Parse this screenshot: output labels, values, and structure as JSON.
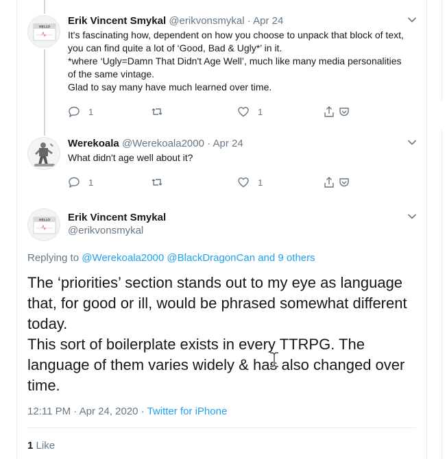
{
  "thread": [
    {
      "name": "Erik Vincent Smykal",
      "handle": "@erikvonsmykal",
      "separator": "·",
      "date": "Apr 24",
      "avatar_icon": "hello-name-tag-avatar",
      "text": "It's fascinating how, dependent on how you choose to unpack that block of text, you can find quite a lot of ‘Good, Bad & Ugly*’ in it.\n*where ‘Ugly=Damn That Didn't Age Well’, much like many media personalities of the same vintage.\nGlad to say many have much learned over time.",
      "replies": "1",
      "retweets": "",
      "likes": "1"
    },
    {
      "name": "Werekoala",
      "handle": "@Werekoala2000",
      "separator": "·",
      "date": "Apr 24",
      "avatar_icon": "robot-figure-avatar",
      "text": "What didn't age well about it?",
      "replies": "1",
      "retweets": "",
      "likes": "1"
    }
  ],
  "focus": {
    "name": "Erik Vincent Smykal",
    "handle": "@erikvonsmykal",
    "avatar_icon": "hello-name-tag-avatar",
    "replying_prefix": "Replying to",
    "mention_1": "@Werekoala2000",
    "mention_2": "@BlackDragonCan",
    "mention_joiner": "and",
    "others": "9 others",
    "text": "The ‘priorities’ section stands out to my eye as language that, for good or ill, would be phrased somewhat different today.\nThis sort of boilerplate exists in every TTRPG. The language of them varies widely & has also changed over time.",
    "timestamp": "12:11 PM · Apr 24, 2020",
    "meta_separator": "·",
    "source": "Twitter for iPhone",
    "like_count": "1",
    "like_label": "Like"
  },
  "colors": {
    "accent": "#1da1f2",
    "secondary_text": "#657786",
    "primary_text": "#14171a",
    "divider": "#e6ecf0"
  }
}
